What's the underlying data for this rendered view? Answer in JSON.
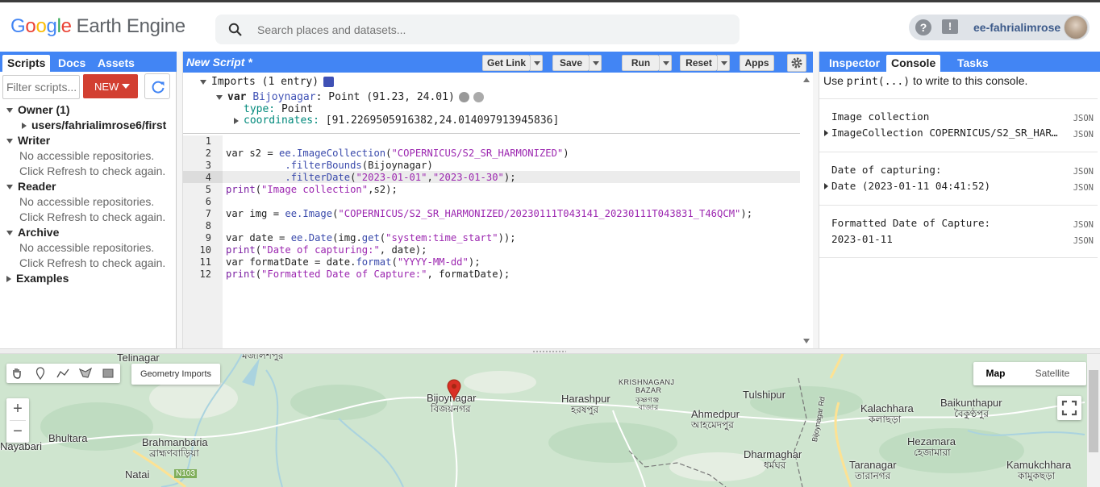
{
  "header": {
    "logo_letters": [
      "G",
      "o",
      "o",
      "g",
      "l",
      "e"
    ],
    "product": "Earth Engine",
    "search_placeholder": "Search places and datasets...",
    "help_icon": "?",
    "feedback_icon": "!",
    "username": "ee-fahrialimrose"
  },
  "left_panel": {
    "tabs": [
      "Scripts",
      "Docs",
      "Assets"
    ],
    "filter_placeholder": "Filter scripts...",
    "new_button": "NEW",
    "tree": {
      "owner": "Owner (1)",
      "owner_path": "users/fahrialimrose6/first",
      "writer": "Writer",
      "writer_note1": "No accessible repositories.",
      "writer_note2": "Click Refresh to check again.",
      "reader": "Reader",
      "reader_note1": "No accessible repositories.",
      "reader_note2": "Click Refresh to check again.",
      "archive": "Archive",
      "archive_note1": "No accessible repositories.",
      "archive_note2": "Click Refresh to check again.",
      "examples": "Examples"
    }
  },
  "editor": {
    "title": "New Script *",
    "buttons": {
      "get_link": "Get Link",
      "save": "Save",
      "run": "Run",
      "reset": "Reset",
      "apps": "Apps"
    },
    "imports": {
      "header": "Imports (1 entry)",
      "var_kw": "var",
      "var_name": "Bijoynagar",
      "var_desc": ": Point (91.23, 24.01)",
      "type_label": "type:",
      "type_value": "Point",
      "coords_label": "coordinates:",
      "coords_value": "[91.2269505916382,24.014097913945836]"
    },
    "line_numbers": [
      "1",
      "2",
      "3",
      "4",
      "5",
      "6",
      "7",
      "8",
      "9",
      "10",
      "11",
      "12"
    ],
    "code": {
      "l2_a": "var s2 = ",
      "l2_b": "ee.ImageCollection",
      "l2_c": "(",
      "l2_d": "\"COPERNICUS/S2_SR_HARMONIZED\"",
      "l2_e": ")",
      "l3_a": "          ",
      "l3_b": ".filterBounds",
      "l3_c": "(Bijoynagar)",
      "l4_a": "          ",
      "l4_b": ".filterDate",
      "l4_c": "(",
      "l4_d": "\"2023-01-01\"",
      "l4_e": ",",
      "l4_f": "\"2023-01-30\"",
      "l4_g": ");",
      "l5_a": "print",
      "l5_b": "(",
      "l5_c": "\"Image collection\"",
      "l5_d": ",s2);",
      "l7_a": "var img = ",
      "l7_b": "ee.Image",
      "l7_c": "(",
      "l7_d": "\"COPERNICUS/S2_SR_HARMONIZED/20230111T043141_20230111T043831_T46QCM\"",
      "l7_e": ");",
      "l9_a": "var date = ",
      "l9_b": "ee.Date",
      "l9_c": "(img.",
      "l9_d": "get",
      "l9_e": "(",
      "l9_f": "\"system:time_start\"",
      "l9_g": "));",
      "l10_a": "print",
      "l10_b": "(",
      "l10_c": "\"Date of capturing:\"",
      "l10_d": ", date);",
      "l11_a": "var formatDate = date.",
      "l11_b": "format",
      "l11_c": "(",
      "l11_d": "\"YYYY-MM-dd\"",
      "l11_e": ");",
      "l12_a": "print",
      "l12_b": "(",
      "l12_c": "\"Formatted Date of Capture:\"",
      "l12_d": ", formatDate);"
    }
  },
  "right_panel": {
    "tabs": [
      "Inspector",
      "Console",
      "Tasks"
    ],
    "hint_pre": "Use ",
    "hint_code": "print(...)",
    "hint_post": " to write to this console.",
    "entries": [
      {
        "line1": "Image collection",
        "line2": "ImageCollection COPERNICUS/S2_SR_HAR…",
        "json": "JSON"
      },
      {
        "line1": "Date of capturing:",
        "line2": "Date (2023-01-11 04:41:52)",
        "json": "JSON"
      },
      {
        "line1": "Formatted Date of Capture:",
        "line2": "2023-01-11",
        "json": "JSON"
      }
    ]
  },
  "map": {
    "geometry_imports": "Geometry Imports",
    "map_type": [
      "Map",
      "Satellite"
    ],
    "zoom_in": "+",
    "zoom_out": "−",
    "labels": {
      "telinagar": "Telinagar",
      "top_bn": "মজলিশপুর",
      "bhultara": "Bhultara",
      "nayabari": "Nayabari",
      "brahmanbaria": "Brahmanbaria",
      "brahmanbaria_bn": "ব্রাহ্মণবাড়িয়া",
      "natai": "Natai",
      "n103": "N103",
      "bijoynagar": "Bijoynagar",
      "bijoynagar_bn": "বিজয়নগর",
      "harashpur": "Harashpur",
      "harashpur_bn": "হরষপুর",
      "krishnaganj_1": "KRISHNAGANJ",
      "krishnaganj_2": "BAZAR",
      "krishnaganj_bn1": "কৃষ্ণগঞ্জ",
      "krishnaganj_bn2": "বাজার",
      "ahmedpur": "Ahmedpur",
      "ahmedpur_bn": "আহমেদপুর",
      "tulshipur": "Tulshipur",
      "dharmaghar": "Dharmaghar",
      "dharmaghar_bn": "ধর্মঘর",
      "kalachhara": "Kalachhara",
      "kalachhara_bn": "কলাছড়া",
      "baikunthapur": "Baikunthapur",
      "baikunthapur_bn": "বৈকুণ্ঠপুর",
      "hezamara": "Hezamara",
      "hezamara_bn": "হেজামারা",
      "taranagar": "Taranagar",
      "taranagar_bn": "তারানগর",
      "kamukchhara": "Kamukchhara",
      "kamukchhara_bn": "কামুকছড়া",
      "bijoynagar_rd": "Bijoynagar Rd"
    }
  },
  "colors": {
    "accent_blue": "#4285f4",
    "new_red": "#d23f31",
    "map_green": "#cde3cf",
    "pin_red": "#d93025"
  }
}
